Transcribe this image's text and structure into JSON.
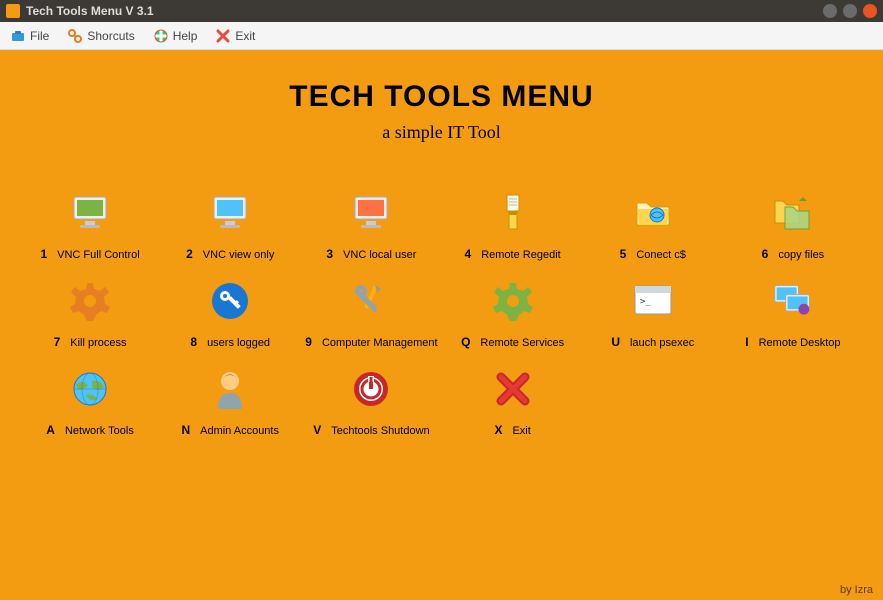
{
  "window": {
    "title": "Tech Tools Menu V 3.1"
  },
  "menubar": {
    "file": "File",
    "shortcuts": "Shorcuts",
    "help": "Help",
    "exit": "Exit"
  },
  "header": {
    "title": "TECH TOOLS MENU",
    "subtitle": "a simple IT Tool"
  },
  "tools": [
    {
      "key": "1",
      "label": "VNC Full Control",
      "icon": "monitor-green"
    },
    {
      "key": "2",
      "label": "VNC view only",
      "icon": "monitor-blue"
    },
    {
      "key": "3",
      "label": "VNC local user",
      "icon": "monitor-orange"
    },
    {
      "key": "4",
      "label": "Remote Regedit",
      "icon": "regedit"
    },
    {
      "key": "5",
      "label": "Conect c$",
      "icon": "folder-network"
    },
    {
      "key": "6",
      "label": "copy files",
      "icon": "folder-copy"
    },
    {
      "key": "7",
      "label": "Kill process",
      "icon": "gear-orange"
    },
    {
      "key": "8",
      "label": "users logged",
      "icon": "key-blue"
    },
    {
      "key": "9",
      "label": "Computer Management",
      "icon": "tools"
    },
    {
      "key": "Q",
      "label": "Remote Services",
      "icon": "gear-green"
    },
    {
      "key": "U",
      "label": "lauch psexec",
      "icon": "terminal"
    },
    {
      "key": "I",
      "label": "Remote Desktop",
      "icon": "monitors-remote"
    },
    {
      "key": "A",
      "label": "Network Tools",
      "icon": "globe"
    },
    {
      "key": "N",
      "label": "Admin  Accounts",
      "icon": "user"
    },
    {
      "key": "V",
      "label": "Techtools Shutdown",
      "icon": "shutdown"
    },
    {
      "key": "X",
      "label": "Exit",
      "icon": "exit-x"
    }
  ],
  "footer": "by Izra"
}
